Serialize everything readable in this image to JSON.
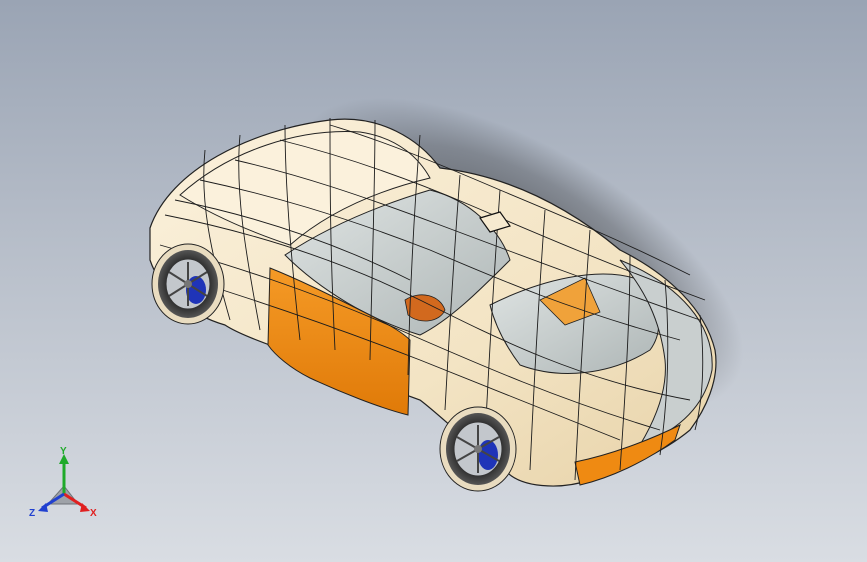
{
  "viewport": {
    "background_top": "#9aa4b4",
    "background_bottom": "#d9dde3"
  },
  "model": {
    "object": "car-surface-model",
    "body_color": "#f3e4c4",
    "highlight_color": "#ef8a12",
    "glass_color": "#c9cfcf",
    "tire_color": "#3a3a3a",
    "rim_color": "#b9bdc2",
    "brake_color": "#1f34b8",
    "grid_line_color": "#1c1c1c"
  },
  "triad": {
    "x_label": "X",
    "y_label": "Y",
    "z_label": "Z",
    "x_color": "#e02020",
    "y_color": "#1faa2a",
    "z_color": "#2040d0"
  }
}
